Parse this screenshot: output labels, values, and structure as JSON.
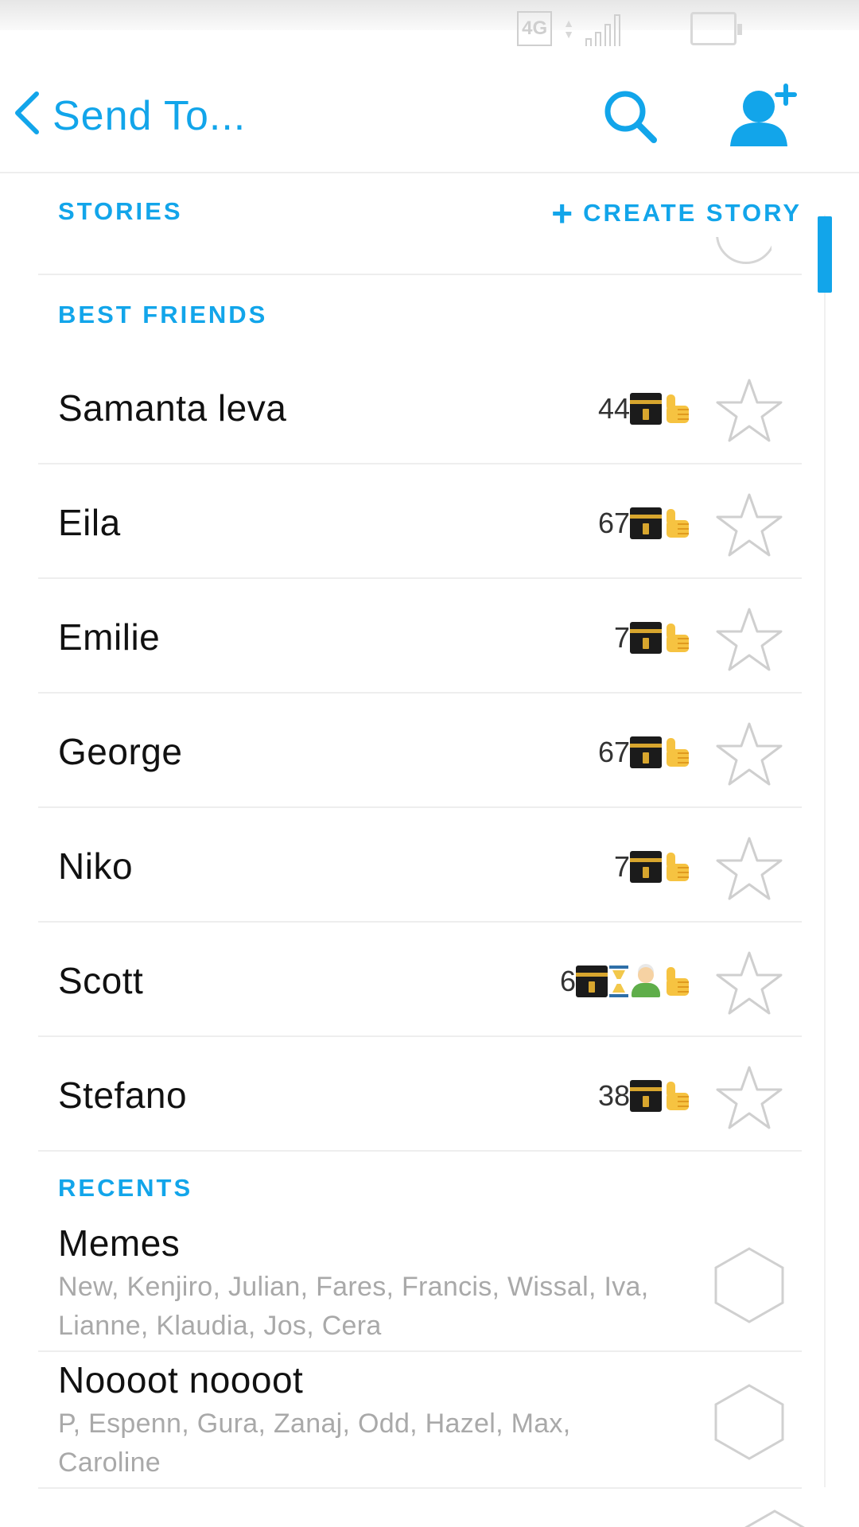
{
  "status_bar": {
    "network": "4G",
    "signal_icon": "signal-bars-icon",
    "battery_icon": "battery-icon"
  },
  "header": {
    "title": "Send To...",
    "back_icon": "chevron-left-icon",
    "search_icon": "search-icon",
    "add_friend_icon": "add-user-icon",
    "accent_color": "#12a5ea"
  },
  "stories": {
    "section_title": "STORIES",
    "create_label": "CREATE STORY"
  },
  "best_friends": {
    "section_title": "BEST FRIENDS",
    "items": [
      {
        "name": "Samanta leva",
        "count": "44",
        "emojis": [
          "kaaba",
          "thumbs-up"
        ]
      },
      {
        "name": "Eila",
        "count": "67",
        "emojis": [
          "kaaba",
          "thumbs-up"
        ]
      },
      {
        "name": "Emilie",
        "count": "7",
        "emojis": [
          "kaaba",
          "thumbs-up"
        ]
      },
      {
        "name": "George",
        "count": "67",
        "emojis": [
          "kaaba",
          "thumbs-up"
        ]
      },
      {
        "name": "Niko",
        "count": "7",
        "emojis": [
          "kaaba",
          "thumbs-up"
        ]
      },
      {
        "name": "Scott",
        "count": "6",
        "emojis": [
          "kaaba",
          "hourglass",
          "person",
          "thumbs-up"
        ]
      },
      {
        "name": "Stefano",
        "count": "38",
        "emojis": [
          "kaaba",
          "thumbs-up"
        ]
      }
    ]
  },
  "recents": {
    "section_title": "RECENTS",
    "groups": [
      {
        "name": "Memes",
        "members": "New, Kenjiro, Julian, Fares, Francis, Wissal, Iva, Lianne, Klaudia, Jos, Cera"
      },
      {
        "name": "Noooot noooot",
        "members": "P, Espenn, Gura, Zanaj, Odd, Hazel, Max, Caroline"
      }
    ]
  }
}
